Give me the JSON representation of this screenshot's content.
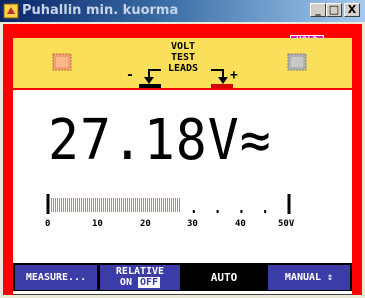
{
  "window": {
    "title": "Puhallin min. kuorma",
    "controls": {
      "minimize": "_",
      "maximize": "□",
      "close": "X"
    }
  },
  "status": {
    "hold_badge": "HOLD",
    "hold_arrow": "-◄"
  },
  "test_leads": {
    "line1": "VOLT",
    "line2": "TEST",
    "line3": "LEADS",
    "minus": "-",
    "plus": "+"
  },
  "reading": {
    "text": "27.18V≈",
    "value": 27.18,
    "unit": "V",
    "mode": "AC"
  },
  "bargraph": {
    "value": 27.18,
    "max": 50,
    "ticks": [
      "0",
      "10",
      "20",
      "30",
      "40",
      "50V"
    ],
    "color": "#4ad028"
  },
  "softkeys": {
    "measure": "MEASURE...",
    "relative_line1": "RELATIVE",
    "relative_on": "ON",
    "relative_off": "OFF",
    "auto": "AUTO",
    "manual": "MANUAL ⇕"
  },
  "colors": {
    "frame": "#ff0000",
    "banner": "#fae05a",
    "softkey": "#3c3ca8",
    "hold": "#d21eb4"
  }
}
